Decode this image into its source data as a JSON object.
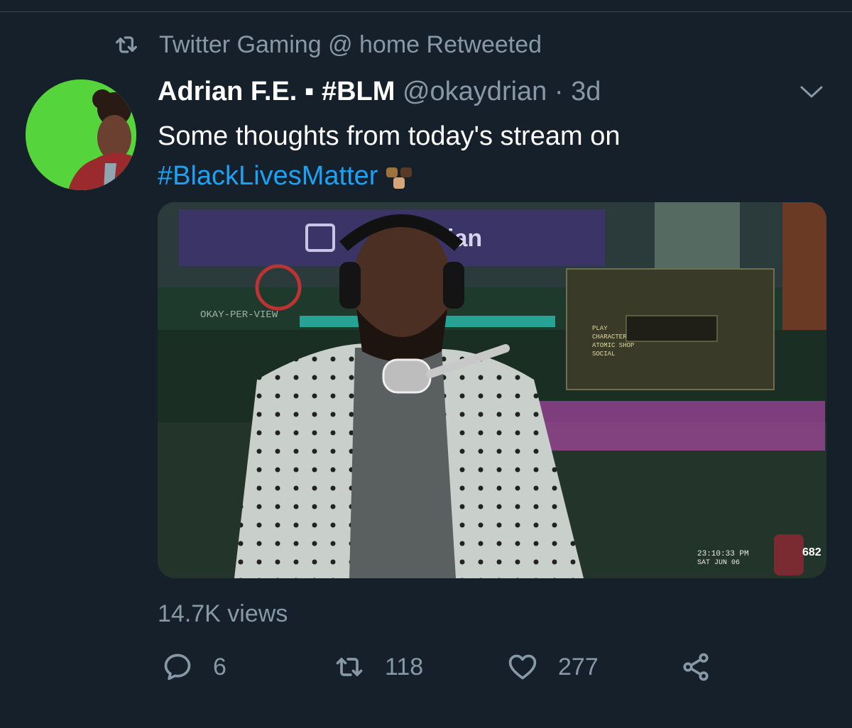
{
  "retweet_banner": {
    "text": "Twitter Gaming @ home Retweeted",
    "icon": "retweet-icon"
  },
  "tweet": {
    "author_name": "Adrian F.E. ▪ #BLM",
    "handle": "@okaydrian",
    "separator": "·",
    "time": "3d",
    "text_line1": "Some thoughts from today's stream on",
    "hashtag": "#BlackLivesMatter",
    "emoji": "raised-fists-emoji",
    "views": "14.7K views",
    "video": {
      "overlay_brand": "ian",
      "overlay_logo": "OKAY-PER-VIEW",
      "game_menu": [
        "PLAY",
        "CHARACTER",
        "ATOMIC SHOP",
        "SOCIAL"
      ],
      "clock_time": "23:10:33 PM",
      "clock_date": "SAT JUN 06",
      "viewer_count": "682"
    }
  },
  "actions": {
    "reply_count": "6",
    "retweet_count": "118",
    "like_count": "277"
  },
  "colors": {
    "background": "#15202b",
    "secondary_text": "#8899a6",
    "link": "#1da1f2",
    "divider": "#38444d"
  }
}
